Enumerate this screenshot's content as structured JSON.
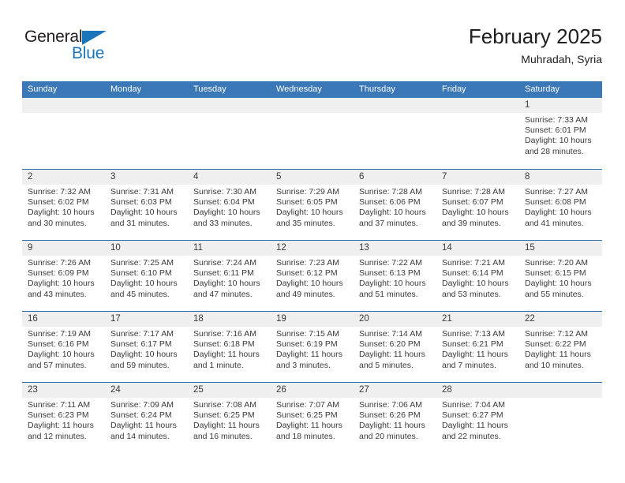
{
  "brand": {
    "name_part1": "General",
    "name_part2": "Blue",
    "flag_icon": "blue-triangle-flag",
    "color_dark": "#231f20",
    "color_blue": "#1b75bb"
  },
  "header": {
    "title": "February 2025",
    "subtitle": "Muhradah, Syria"
  },
  "theme": {
    "header_blue": "#3b78b8",
    "row_divider_blue": "#2e6da8",
    "daynum_band": "#efefef",
    "text": "#3a3a3a"
  },
  "weekdays": [
    "Sunday",
    "Monday",
    "Tuesday",
    "Wednesday",
    "Thursday",
    "Friday",
    "Saturday"
  ],
  "weeks": [
    [
      {
        "day": "",
        "sunrise": "",
        "sunset": "",
        "daylight1": "",
        "daylight2": ""
      },
      {
        "day": "",
        "sunrise": "",
        "sunset": "",
        "daylight1": "",
        "daylight2": ""
      },
      {
        "day": "",
        "sunrise": "",
        "sunset": "",
        "daylight1": "",
        "daylight2": ""
      },
      {
        "day": "",
        "sunrise": "",
        "sunset": "",
        "daylight1": "",
        "daylight2": ""
      },
      {
        "day": "",
        "sunrise": "",
        "sunset": "",
        "daylight1": "",
        "daylight2": ""
      },
      {
        "day": "",
        "sunrise": "",
        "sunset": "",
        "daylight1": "",
        "daylight2": ""
      },
      {
        "day": "1",
        "sunrise": "Sunrise: 7:33 AM",
        "sunset": "Sunset: 6:01 PM",
        "daylight1": "Daylight: 10 hours",
        "daylight2": "and 28 minutes."
      }
    ],
    [
      {
        "day": "2",
        "sunrise": "Sunrise: 7:32 AM",
        "sunset": "Sunset: 6:02 PM",
        "daylight1": "Daylight: 10 hours",
        "daylight2": "and 30 minutes."
      },
      {
        "day": "3",
        "sunrise": "Sunrise: 7:31 AM",
        "sunset": "Sunset: 6:03 PM",
        "daylight1": "Daylight: 10 hours",
        "daylight2": "and 31 minutes."
      },
      {
        "day": "4",
        "sunrise": "Sunrise: 7:30 AM",
        "sunset": "Sunset: 6:04 PM",
        "daylight1": "Daylight: 10 hours",
        "daylight2": "and 33 minutes."
      },
      {
        "day": "5",
        "sunrise": "Sunrise: 7:29 AM",
        "sunset": "Sunset: 6:05 PM",
        "daylight1": "Daylight: 10 hours",
        "daylight2": "and 35 minutes."
      },
      {
        "day": "6",
        "sunrise": "Sunrise: 7:28 AM",
        "sunset": "Sunset: 6:06 PM",
        "daylight1": "Daylight: 10 hours",
        "daylight2": "and 37 minutes."
      },
      {
        "day": "7",
        "sunrise": "Sunrise: 7:28 AM",
        "sunset": "Sunset: 6:07 PM",
        "daylight1": "Daylight: 10 hours",
        "daylight2": "and 39 minutes."
      },
      {
        "day": "8",
        "sunrise": "Sunrise: 7:27 AM",
        "sunset": "Sunset: 6:08 PM",
        "daylight1": "Daylight: 10 hours",
        "daylight2": "and 41 minutes."
      }
    ],
    [
      {
        "day": "9",
        "sunrise": "Sunrise: 7:26 AM",
        "sunset": "Sunset: 6:09 PM",
        "daylight1": "Daylight: 10 hours",
        "daylight2": "and 43 minutes."
      },
      {
        "day": "10",
        "sunrise": "Sunrise: 7:25 AM",
        "sunset": "Sunset: 6:10 PM",
        "daylight1": "Daylight: 10 hours",
        "daylight2": "and 45 minutes."
      },
      {
        "day": "11",
        "sunrise": "Sunrise: 7:24 AM",
        "sunset": "Sunset: 6:11 PM",
        "daylight1": "Daylight: 10 hours",
        "daylight2": "and 47 minutes."
      },
      {
        "day": "12",
        "sunrise": "Sunrise: 7:23 AM",
        "sunset": "Sunset: 6:12 PM",
        "daylight1": "Daylight: 10 hours",
        "daylight2": "and 49 minutes."
      },
      {
        "day": "13",
        "sunrise": "Sunrise: 7:22 AM",
        "sunset": "Sunset: 6:13 PM",
        "daylight1": "Daylight: 10 hours",
        "daylight2": "and 51 minutes."
      },
      {
        "day": "14",
        "sunrise": "Sunrise: 7:21 AM",
        "sunset": "Sunset: 6:14 PM",
        "daylight1": "Daylight: 10 hours",
        "daylight2": "and 53 minutes."
      },
      {
        "day": "15",
        "sunrise": "Sunrise: 7:20 AM",
        "sunset": "Sunset: 6:15 PM",
        "daylight1": "Daylight: 10 hours",
        "daylight2": "and 55 minutes."
      }
    ],
    [
      {
        "day": "16",
        "sunrise": "Sunrise: 7:19 AM",
        "sunset": "Sunset: 6:16 PM",
        "daylight1": "Daylight: 10 hours",
        "daylight2": "and 57 minutes."
      },
      {
        "day": "17",
        "sunrise": "Sunrise: 7:17 AM",
        "sunset": "Sunset: 6:17 PM",
        "daylight1": "Daylight: 10 hours",
        "daylight2": "and 59 minutes."
      },
      {
        "day": "18",
        "sunrise": "Sunrise: 7:16 AM",
        "sunset": "Sunset: 6:18 PM",
        "daylight1": "Daylight: 11 hours",
        "daylight2": "and 1 minute."
      },
      {
        "day": "19",
        "sunrise": "Sunrise: 7:15 AM",
        "sunset": "Sunset: 6:19 PM",
        "daylight1": "Daylight: 11 hours",
        "daylight2": "and 3 minutes."
      },
      {
        "day": "20",
        "sunrise": "Sunrise: 7:14 AM",
        "sunset": "Sunset: 6:20 PM",
        "daylight1": "Daylight: 11 hours",
        "daylight2": "and 5 minutes."
      },
      {
        "day": "21",
        "sunrise": "Sunrise: 7:13 AM",
        "sunset": "Sunset: 6:21 PM",
        "daylight1": "Daylight: 11 hours",
        "daylight2": "and 7 minutes."
      },
      {
        "day": "22",
        "sunrise": "Sunrise: 7:12 AM",
        "sunset": "Sunset: 6:22 PM",
        "daylight1": "Daylight: 11 hours",
        "daylight2": "and 10 minutes."
      }
    ],
    [
      {
        "day": "23",
        "sunrise": "Sunrise: 7:11 AM",
        "sunset": "Sunset: 6:23 PM",
        "daylight1": "Daylight: 11 hours",
        "daylight2": "and 12 minutes."
      },
      {
        "day": "24",
        "sunrise": "Sunrise: 7:09 AM",
        "sunset": "Sunset: 6:24 PM",
        "daylight1": "Daylight: 11 hours",
        "daylight2": "and 14 minutes."
      },
      {
        "day": "25",
        "sunrise": "Sunrise: 7:08 AM",
        "sunset": "Sunset: 6:25 PM",
        "daylight1": "Daylight: 11 hours",
        "daylight2": "and 16 minutes."
      },
      {
        "day": "26",
        "sunrise": "Sunrise: 7:07 AM",
        "sunset": "Sunset: 6:25 PM",
        "daylight1": "Daylight: 11 hours",
        "daylight2": "and 18 minutes."
      },
      {
        "day": "27",
        "sunrise": "Sunrise: 7:06 AM",
        "sunset": "Sunset: 6:26 PM",
        "daylight1": "Daylight: 11 hours",
        "daylight2": "and 20 minutes."
      },
      {
        "day": "28",
        "sunrise": "Sunrise: 7:04 AM",
        "sunset": "Sunset: 6:27 PM",
        "daylight1": "Daylight: 11 hours",
        "daylight2": "and 22 minutes."
      },
      {
        "day": "",
        "sunrise": "",
        "sunset": "",
        "daylight1": "",
        "daylight2": ""
      }
    ]
  ]
}
